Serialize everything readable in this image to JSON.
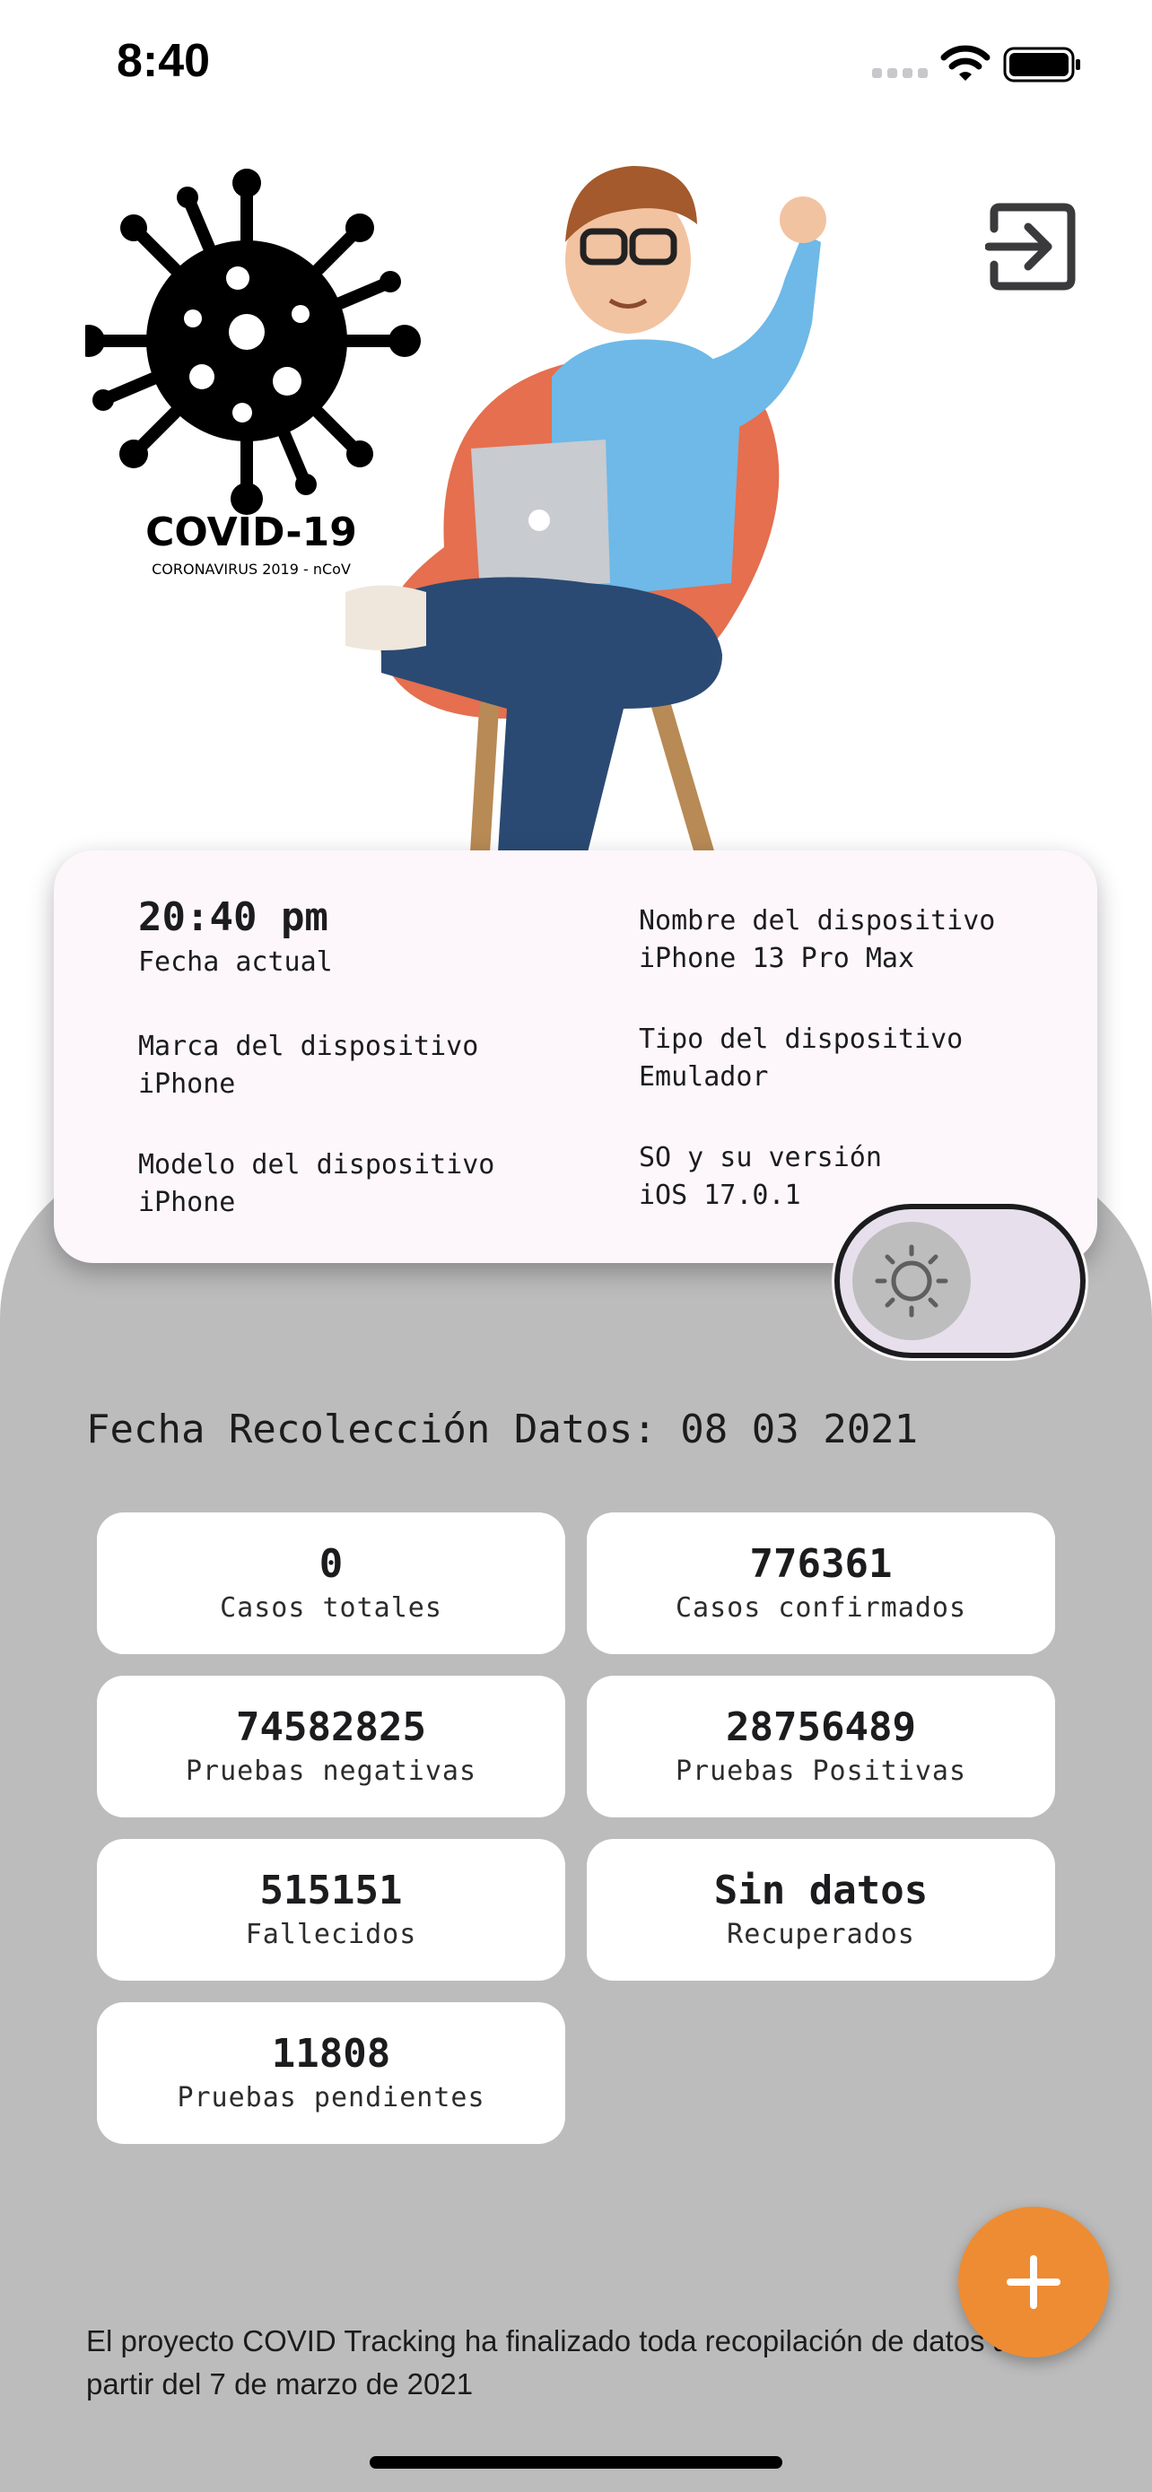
{
  "status_bar": {
    "time": "8:40"
  },
  "logo": {
    "title": "COVID-19",
    "subtitle": "CORONAVIRUS 2019 - nCoV"
  },
  "device_info": {
    "current_time": "20:40 pm",
    "current_date_label": "Fecha actual",
    "brand_label": "Marca del dispositivo",
    "brand_value": "iPhone",
    "model_label": "Modelo del dispositivo",
    "model_value": "iPhone",
    "name_label": "Nombre del dispositivo",
    "name_value": "iPhone 13 Pro Max",
    "type_label": "Tipo del dispositivo",
    "type_value": "Emulador",
    "os_label": "SO y su versión",
    "os_value": "iOS 17.0.1"
  },
  "data_date": "Fecha Recolección Datos: 08 03 2021",
  "stats": [
    {
      "value": "0",
      "label": "Casos totales"
    },
    {
      "value": "776361",
      "label": "Casos confirmados"
    },
    {
      "value": "74582825",
      "label": "Pruebas negativas"
    },
    {
      "value": "28756489",
      "label": "Pruebas Positivas"
    },
    {
      "value": "515151",
      "label": "Fallecidos"
    },
    {
      "value": "Sin datos",
      "label": "Recuperados"
    },
    {
      "value": "11808",
      "label": "Pruebas pendientes"
    }
  ],
  "footer_note": "El proyecto COVID Tracking ha finalizado toda recopilación de datos a partir del 7 de marzo de 2021",
  "icons": {
    "exit": "exit-icon",
    "toggle": "sun-icon",
    "fab": "plus-icon",
    "logo": "virus-icon"
  },
  "colors": {
    "accent": "#ee8c33",
    "panel": "#bcbcbc",
    "card": "#fdf7fb"
  }
}
